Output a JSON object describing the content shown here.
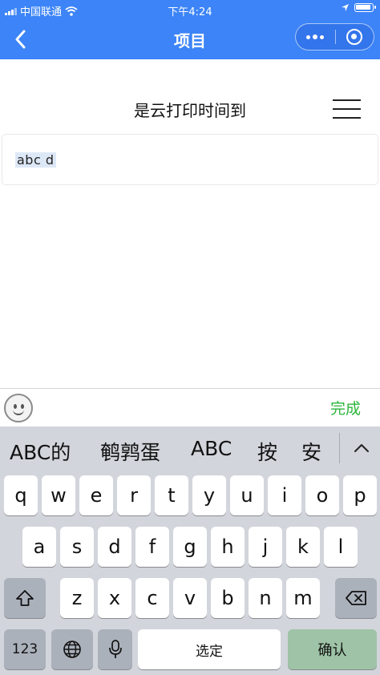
{
  "status_bar": {
    "carrier": "中国联通",
    "time": "下午4:24"
  },
  "nav": {
    "title": "项目"
  },
  "content": {
    "heading": "是云打印时间到",
    "input_value": "abc d"
  },
  "accessory": {
    "done_label": "完成"
  },
  "keyboard": {
    "candidates": [
      "ABC的",
      "鹌鹑蛋",
      "ABC",
      "按",
      "安"
    ],
    "rows": [
      [
        "q",
        "w",
        "e",
        "r",
        "t",
        "y",
        "u",
        "i",
        "o",
        "p"
      ],
      [
        "a",
        "s",
        "d",
        "f",
        "g",
        "h",
        "j",
        "k",
        "l"
      ],
      [
        "z",
        "x",
        "c",
        "v",
        "b",
        "n",
        "m"
      ]
    ],
    "number_key": "123",
    "space_label": "选定",
    "confirm_label": "确认"
  },
  "colors": {
    "nav_background": "#3c84f7",
    "done_text": "#2cb53c",
    "keyboard_background": "#d2d5db",
    "confirm_key": "#9ec3a6"
  },
  "icons": [
    "back-chevron-icon",
    "more-dots-icon",
    "close-target-icon",
    "menu-icon",
    "emoji-icon",
    "shift-icon",
    "delete-icon",
    "globe-icon",
    "microphone-icon",
    "wifi-icon",
    "location-arrow-icon",
    "battery-icon"
  ]
}
